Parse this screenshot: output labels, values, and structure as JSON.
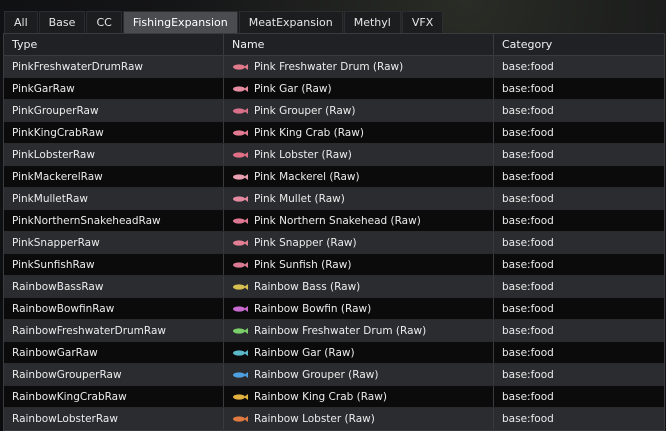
{
  "tabs": [
    {
      "label": "All",
      "active": false
    },
    {
      "label": "Base",
      "active": false
    },
    {
      "label": "CC",
      "active": false
    },
    {
      "label": "FishingExpansion",
      "active": true
    },
    {
      "label": "MeatExpansion",
      "active": false
    },
    {
      "label": "Methyl",
      "active": false
    },
    {
      "label": "VFX",
      "active": false
    }
  ],
  "columns": {
    "type": "Type",
    "name": "Name",
    "category": "Category"
  },
  "rows": [
    {
      "type": "PinkFreshwaterDrumRaw",
      "name": "Pink Freshwater Drum (Raw)",
      "category": "base:food",
      "icon": "pink-fish-icon",
      "color": "#e07a8a"
    },
    {
      "type": "PinkGarRaw",
      "name": "Pink Gar (Raw)",
      "category": "base:food",
      "icon": "pink-fish-icon",
      "color": "#e58ca0"
    },
    {
      "type": "PinkGrouperRaw",
      "name": "Pink Grouper (Raw)",
      "category": "base:food",
      "icon": "pink-fish-icon",
      "color": "#d9708a"
    },
    {
      "type": "PinkKingCrabRaw",
      "name": "Pink King Crab (Raw)",
      "category": "base:food",
      "icon": "pink-crab-icon",
      "color": "#e27b92"
    },
    {
      "type": "PinkLobsterRaw",
      "name": "Pink Lobster (Raw)",
      "category": "base:food",
      "icon": "pink-lobster-icon",
      "color": "#e06f86"
    },
    {
      "type": "PinkMackerelRaw",
      "name": "Pink Mackerel (Raw)",
      "category": "base:food",
      "icon": "pink-fish-icon",
      "color": "#e8a0b0"
    },
    {
      "type": "PinkMulletRaw",
      "name": "Pink Mullet (Raw)",
      "category": "base:food",
      "icon": "pink-fish-icon",
      "color": "#e48aa0"
    },
    {
      "type": "PinkNorthernSnakeheadRaw",
      "name": "Pink Northern Snakehead (Raw)",
      "category": "base:food",
      "icon": "pink-fish-icon",
      "color": "#dd7690"
    },
    {
      "type": "PinkSnapperRaw",
      "name": "Pink Snapper (Raw)",
      "category": "base:food",
      "icon": "pink-fish-icon",
      "color": "#e37f95"
    },
    {
      "type": "PinkSunfishRaw",
      "name": "Pink Sunfish (Raw)",
      "category": "base:food",
      "icon": "pink-fish-icon",
      "color": "#d97a92"
    },
    {
      "type": "RainbowBassRaw",
      "name": "Rainbow Bass (Raw)",
      "category": "base:food",
      "icon": "rainbow-fish-icon",
      "color": "#d7c050"
    },
    {
      "type": "RainbowBowfinRaw",
      "name": "Rainbow Bowfin (Raw)",
      "category": "base:food",
      "icon": "rainbow-fish-icon",
      "color": "#c86ad0"
    },
    {
      "type": "RainbowFreshwaterDrumRaw",
      "name": "Rainbow Freshwater Drum (Raw)",
      "category": "base:food",
      "icon": "rainbow-fish-icon",
      "color": "#7bcf6a"
    },
    {
      "type": "RainbowGarRaw",
      "name": "Rainbow Gar (Raw)",
      "category": "base:food",
      "icon": "rainbow-fish-icon",
      "color": "#5ab8c8"
    },
    {
      "type": "RainbowGrouperRaw",
      "name": "Rainbow Grouper (Raw)",
      "category": "base:food",
      "icon": "rainbow-fish-icon",
      "color": "#4fa0e0"
    },
    {
      "type": "RainbowKingCrabRaw",
      "name": "Rainbow King Crab (Raw)",
      "category": "base:food",
      "icon": "rainbow-crab-icon",
      "color": "#e0b040"
    },
    {
      "type": "RainbowLobsterRaw",
      "name": "Rainbow Lobster (Raw)",
      "category": "base:food",
      "icon": "rainbow-lobster-icon",
      "color": "#e07a40"
    }
  ]
}
